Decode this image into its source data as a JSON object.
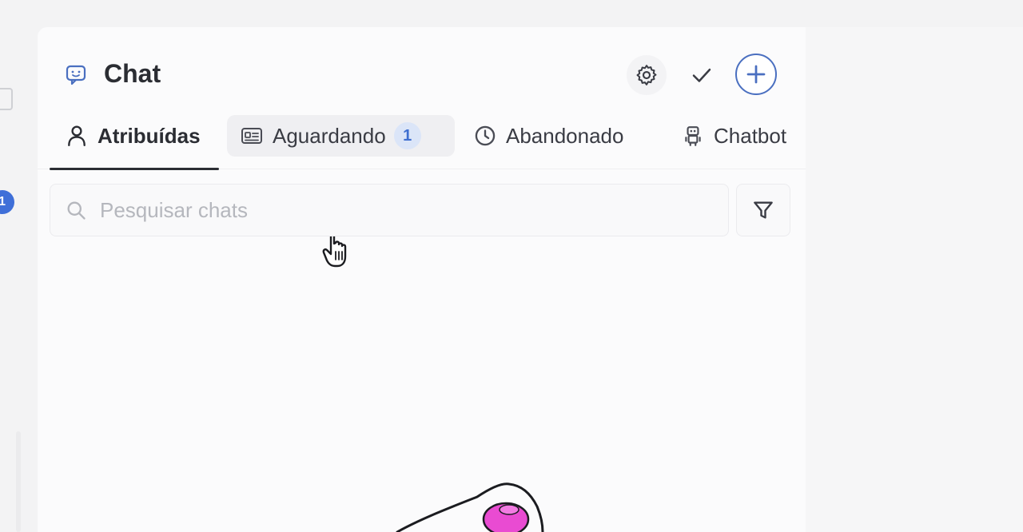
{
  "header": {
    "title": "Chat",
    "icons": {
      "title": "chat-bubble-icon",
      "settings": "gear-icon",
      "resolve": "check-icon",
      "add": "plus-icon"
    }
  },
  "tabs": [
    {
      "label": "Atribuídas",
      "icon": "user-icon",
      "active": true
    },
    {
      "label": "Aguardando",
      "icon": "id-card-icon",
      "count": "1",
      "hovered": true
    },
    {
      "label": "Abandonado",
      "icon": "clock-icon"
    },
    {
      "label": "Chatbot",
      "icon": "robot-icon"
    }
  ],
  "search": {
    "placeholder": "Pesquisar chats",
    "value": "",
    "icon": "search-icon",
    "filter_icon": "filter-icon"
  },
  "left_rail": {
    "badge": "1"
  },
  "colors": {
    "accent": "#4a6fc0",
    "badge_bg": "#dbe5f8",
    "badge_text": "#3f6fd0",
    "illustration_pink": "#e94bd2"
  }
}
